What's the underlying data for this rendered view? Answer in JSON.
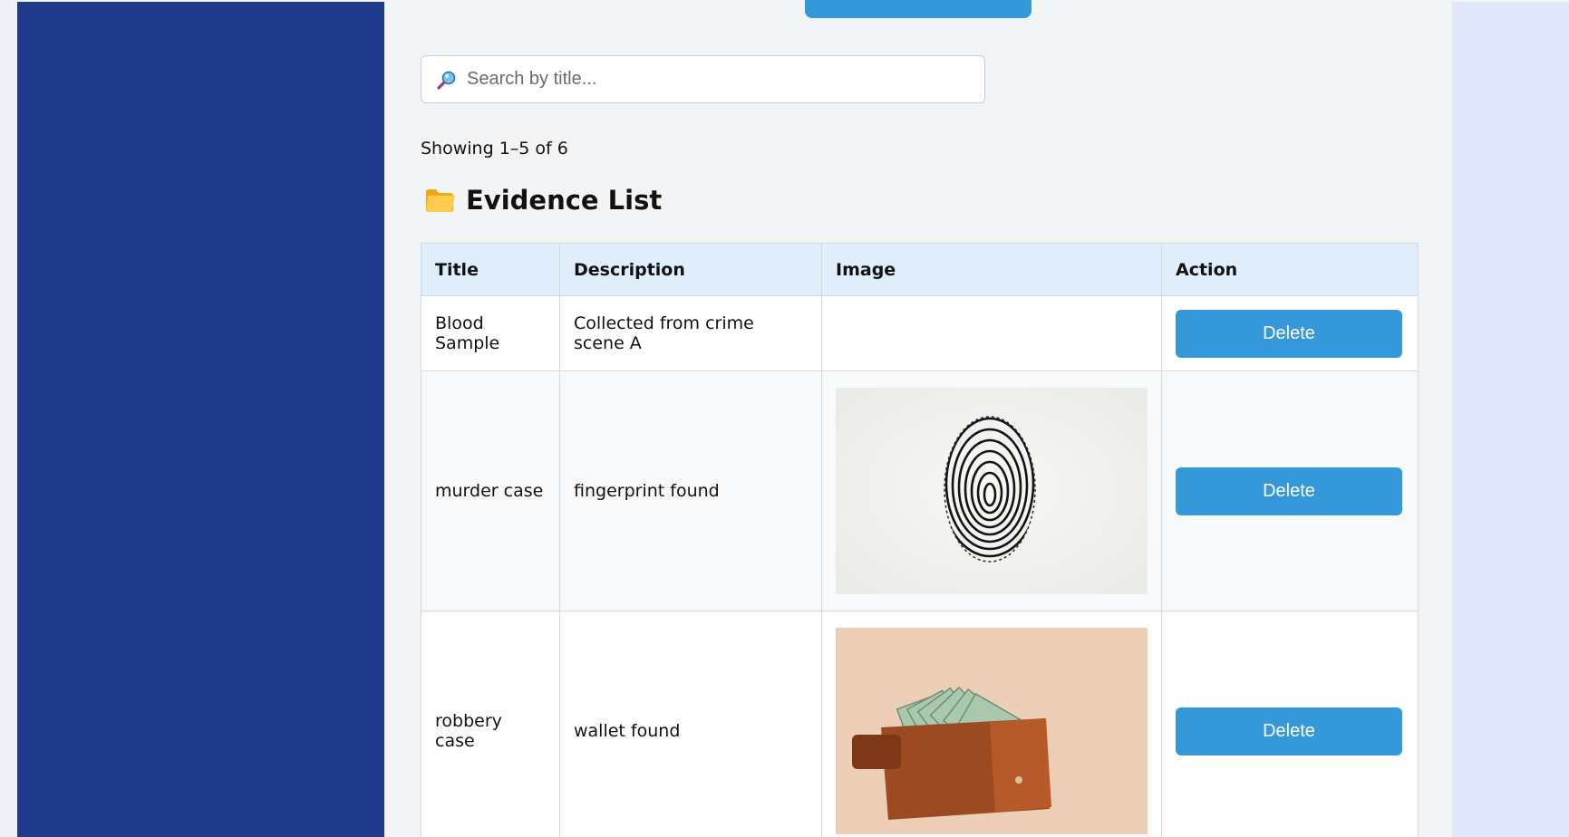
{
  "search": {
    "placeholder": "Search by title..."
  },
  "pagination": {
    "showing_text": "Showing 1–5 of 6"
  },
  "evidence_list": {
    "heading": "Evidence List",
    "columns": [
      "Title",
      "Description",
      "Image",
      "Action"
    ],
    "rows": [
      {
        "title": "Blood Sample",
        "description": "Collected from crime scene A",
        "image": "",
        "action": "Delete"
      },
      {
        "title": "murder case",
        "description": "fingerprint found",
        "image": "fingerprint-photo",
        "action": "Delete"
      },
      {
        "title": "robbery case",
        "description": "wallet found",
        "image": "wallet-with-cash-photo",
        "action": "Delete"
      }
    ]
  },
  "icons": {
    "search": "magnifier-icon",
    "heading": "folder-icon"
  },
  "colors": {
    "sidebar": "#1f3a8a",
    "accent": "#3498db",
    "table_header": "#e0eefb",
    "right_panel": "#dfe9fb"
  }
}
